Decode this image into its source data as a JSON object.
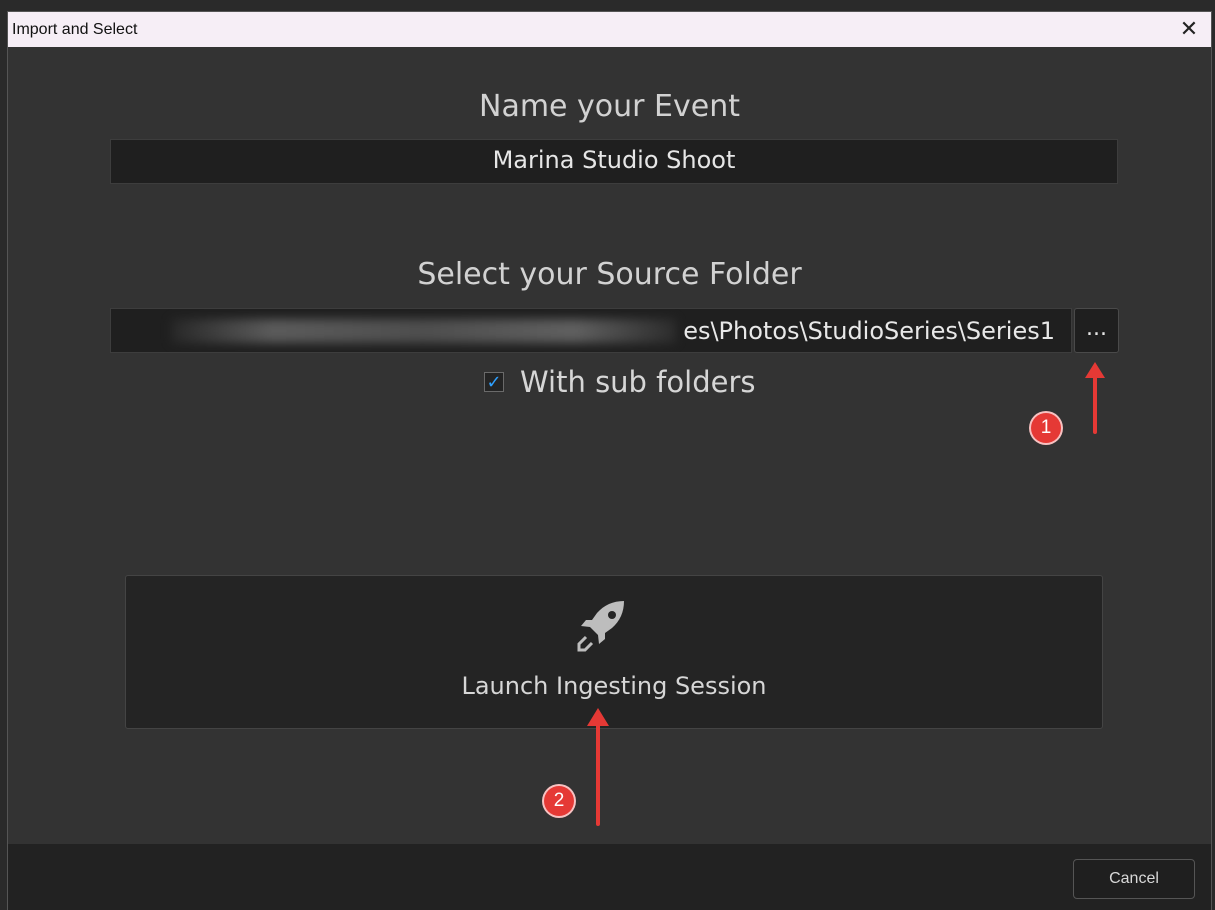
{
  "window": {
    "title": "Import and Select",
    "close_symbol": "✕"
  },
  "event": {
    "heading": "Name your Event",
    "value": "Marina Studio Shoot"
  },
  "source": {
    "heading": "Select your Source Folder",
    "path_visible": "es\\Photos\\StudioSeries\\Series1",
    "browse_label": "...",
    "subfolders_label": "With sub folders",
    "subfolders_checked": true,
    "check_symbol": "✓"
  },
  "launch": {
    "label": "Launch Ingesting Session",
    "icon": "rocket-icon"
  },
  "footer": {
    "cancel_label": "Cancel"
  },
  "annotations": {
    "badge1": "1",
    "badge2": "2"
  },
  "colors": {
    "accent_check": "#2ea0ff",
    "annotation_red": "#e53935"
  }
}
